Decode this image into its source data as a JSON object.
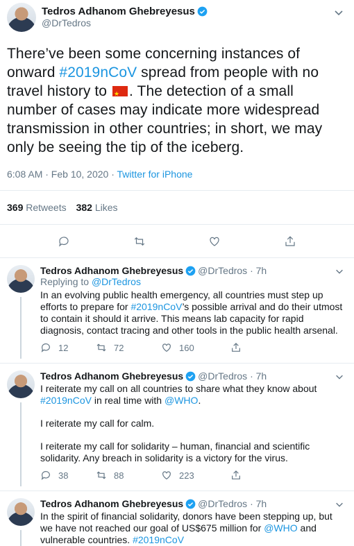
{
  "main_tweet": {
    "author_name": "Tedros Adhanom Ghebreyesus",
    "author_handle": "@DrTedros",
    "text_part1": "There’ve been some concerning instances of onward ",
    "hashtag": "#2019nCoV",
    "text_part2": " spread from people with no travel history to ",
    "text_part3": ". The detection of a small number of cases may indicate more widespread transmission in other countries; in short, we may only be seeing the tip of the iceberg.",
    "timestamp": "6:08 AM · Feb 10, 2020 · ",
    "source": "Twitter for iPhone",
    "retweets_count": "369",
    "retweets_label": "Retweets",
    "likes_count": "382",
    "likes_label": "Likes"
  },
  "replies": [
    {
      "author_name": "Tedros Adhanom Ghebreyesus",
      "author_handle": "@DrTedros · 7h",
      "replying_label": "Replying to ",
      "replying_handle": "@DrTedros",
      "text_a": "In an evolving public health emergency, all countries must step up efforts to prepare for ",
      "hashtag": "#2019nCoV",
      "text_b": "’s possible arrival and do their utmost to contain it should it arrive. This means lab capacity for rapid diagnosis, contact tracing and other tools in the public health arsenal.",
      "reply_count": "12",
      "retweet_count": "72",
      "like_count": "160"
    },
    {
      "author_name": "Tedros Adhanom Ghebreyesus",
      "author_handle": "@DrTedros · 7h",
      "p1_a": "I reiterate my call on all countries to share what they know about ",
      "p1_hashtag": "#2019nCoV",
      "p1_b": " in real time with ",
      "p1_mention": "@WHO",
      "p1_c": ".",
      "p2": "I reiterate my call for calm.",
      "p3": "I reiterate my call for solidarity – human, financial and scientific solidarity. Any breach in solidarity is a victory for the virus.",
      "reply_count": "38",
      "retweet_count": "88",
      "like_count": "223"
    },
    {
      "author_name": "Tedros Adhanom Ghebreyesus",
      "author_handle": "@DrTedros · 7h",
      "text_a": "In the spirit of financial solidarity, donors have been stepping up, but we have not reached our goal of US$675 million for ",
      "mention": "@WHO",
      "text_b": " and vulnerable countries. ",
      "hashtag": "#2019nCoV"
    }
  ],
  "icons": {
    "verified": "verified-badge-icon",
    "chevron": "chevron-down-icon",
    "reply": "reply-icon",
    "retweet": "retweet-icon",
    "like": "heart-icon",
    "share": "share-icon",
    "flag": "china-flag-emoji"
  },
  "colors": {
    "link": "#1b95e0",
    "muted": "#657786",
    "text": "#14171a",
    "divider": "#e6ecf0"
  }
}
